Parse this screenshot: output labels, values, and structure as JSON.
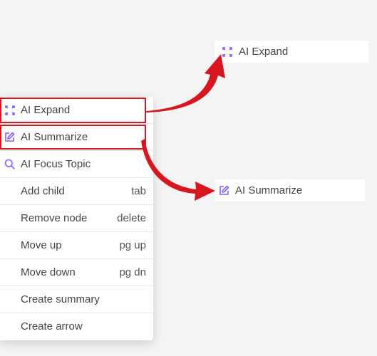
{
  "accent_color": "#8b5cf6",
  "annotation_color": "#d8161f",
  "context_menu": {
    "items": [
      {
        "label": "AI Expand",
        "shortcut": "",
        "icon": "expand-icon",
        "highlighted": true
      },
      {
        "label": "AI Summarize",
        "shortcut": "",
        "icon": "edit-icon",
        "highlighted": true
      },
      {
        "label": "AI Focus Topic",
        "shortcut": "",
        "icon": "search-icon",
        "highlighted": false
      },
      {
        "label": "Add child",
        "shortcut": "tab",
        "icon": "",
        "highlighted": false
      },
      {
        "label": "Remove node",
        "shortcut": "delete",
        "icon": "",
        "highlighted": false
      },
      {
        "label": "Move up",
        "shortcut": "pg up",
        "icon": "",
        "highlighted": false
      },
      {
        "label": "Move down",
        "shortcut": "pg dn",
        "icon": "",
        "highlighted": false
      },
      {
        "label": "Create summary",
        "shortcut": "",
        "icon": "",
        "highlighted": false
      },
      {
        "label": "Create arrow",
        "shortcut": "",
        "icon": "",
        "highlighted": false
      }
    ]
  },
  "callouts": {
    "expand": {
      "label": "AI Expand",
      "icon": "expand-icon"
    },
    "summarize": {
      "label": "AI Summarize",
      "icon": "edit-icon"
    }
  }
}
